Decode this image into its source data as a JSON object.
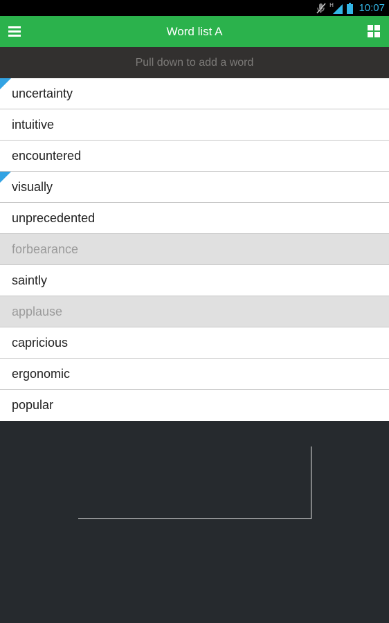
{
  "status_bar": {
    "time": "10:07",
    "icons": [
      "muted-mic-icon",
      "signal-h-icon",
      "battery-icon"
    ],
    "time_color": "#33b5e5"
  },
  "app_bar": {
    "title": "Word list A",
    "menu_icon": "hamburger-menu-icon",
    "grid_icon": "grid-view-icon",
    "color": "#2bb24c"
  },
  "pull_hint": {
    "text": "Pull down to add a word"
  },
  "words": [
    {
      "text": "uncertainty",
      "flagged": true,
      "dimmed": false
    },
    {
      "text": "intuitive",
      "flagged": false,
      "dimmed": false
    },
    {
      "text": "encountered",
      "flagged": false,
      "dimmed": false
    },
    {
      "text": "visually",
      "flagged": true,
      "dimmed": false
    },
    {
      "text": "unprecedented",
      "flagged": false,
      "dimmed": false
    },
    {
      "text": "forbearance",
      "flagged": false,
      "dimmed": true
    },
    {
      "text": "saintly",
      "flagged": false,
      "dimmed": false
    },
    {
      "text": "applause",
      "flagged": false,
      "dimmed": true
    },
    {
      "text": "capricious",
      "flagged": false,
      "dimmed": false
    },
    {
      "text": "ergonomic",
      "flagged": false,
      "dimmed": false
    },
    {
      "text": "popular",
      "flagged": false,
      "dimmed": false
    }
  ],
  "colors": {
    "flag": "#33a3e3",
    "dimmed_row": "#e0e0e0",
    "background": "#262a2e"
  }
}
